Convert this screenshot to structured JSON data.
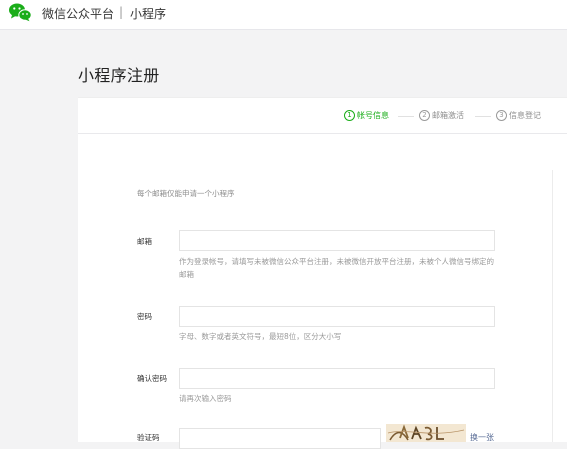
{
  "topbar": {
    "brand": "微信公众平台",
    "separator": "|",
    "section": "小程序"
  },
  "page": {
    "title": "小程序注册"
  },
  "steps": [
    {
      "num": "1",
      "label": "帐号信息",
      "state": "active"
    },
    {
      "num": "2",
      "label": "邮箱激活",
      "state": "inactive"
    },
    {
      "num": "3",
      "label": "信息登记",
      "state": "inactive"
    }
  ],
  "form": {
    "intro": "每个邮箱仅能申请一个小程序",
    "email": {
      "label": "邮箱",
      "value": "",
      "hint": "作为登录帐号，请填写未被微信公众平台注册，未被微信开放平台注册，未被个人微信号绑定的邮箱"
    },
    "password": {
      "label": "密码",
      "value": "",
      "hint": "字母、数字或者英文符号，最短8位，区分大小写"
    },
    "confirm_password": {
      "label": "确认密码",
      "value": "",
      "hint": "请再次输入密码"
    },
    "captcha": {
      "label": "验证码",
      "value": "",
      "refresh_label": "换一张"
    }
  },
  "colors": {
    "accent": "#1aad19",
    "link": "#576b95",
    "background": "#f3f3f4"
  }
}
